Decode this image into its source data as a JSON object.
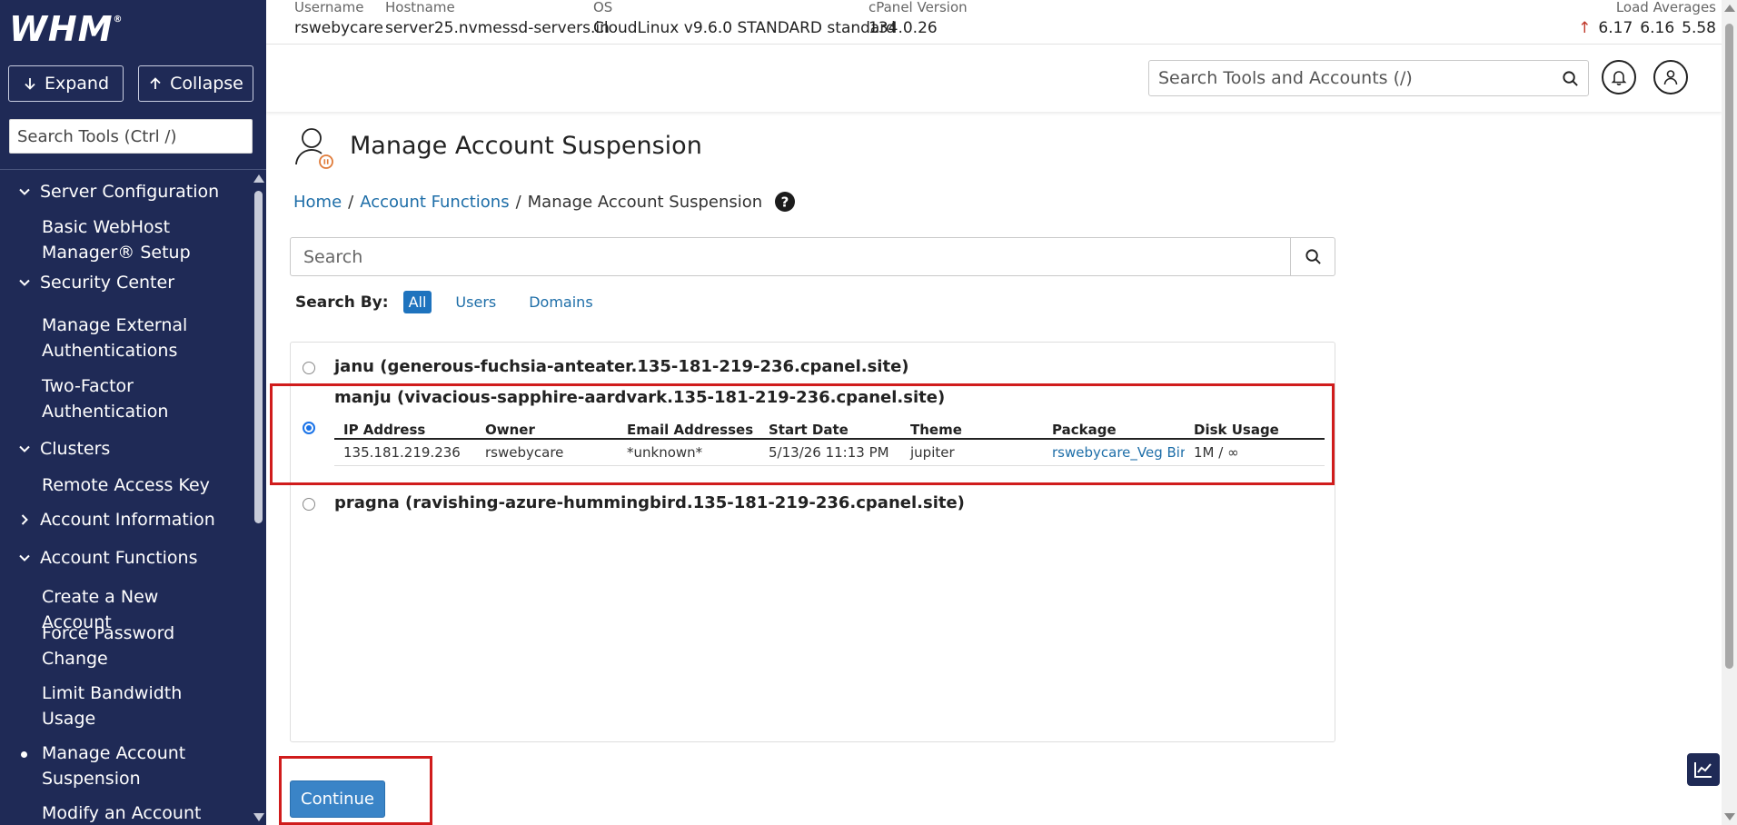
{
  "sidebar": {
    "logo": "WHM",
    "logo_mark": "®",
    "expand_label": "Expand",
    "collapse_label": "Collapse",
    "search_placeholder": "Search Tools (Ctrl /)",
    "sections": [
      {
        "label": "Server Configuration",
        "expanded": true
      },
      {
        "label": "Security Center",
        "expanded": true
      },
      {
        "label": "Clusters",
        "expanded": true
      },
      {
        "label": "Account Information",
        "expanded": false
      },
      {
        "label": "Account Functions",
        "expanded": true
      }
    ],
    "items": [
      {
        "label": "Basic WebHost Manager® Setup"
      },
      {
        "label": "Manage External Authentications"
      },
      {
        "label": "Two-Factor Authentication"
      },
      {
        "label": "Remote Access Key"
      },
      {
        "label": "Create a New Account"
      },
      {
        "label": "Force Password Change"
      },
      {
        "label": "Limit Bandwidth Usage"
      },
      {
        "label": "Manage Account Suspension",
        "active": true
      },
      {
        "label": "Modify an Account"
      }
    ]
  },
  "server_info": {
    "username_label": "Username",
    "username": "rswebycare",
    "hostname_label": "Hostname",
    "hostname": "server25.nvmessd-servers.in",
    "os_label": "OS",
    "os": "CloudLinux v9.6.0 STANDARD standard",
    "version_label": "cPanel Version",
    "version": "134.0.26",
    "load_label": "Load Averages",
    "load": [
      "6.17",
      "6.16",
      "5.58"
    ]
  },
  "header": {
    "search_placeholder": "Search Tools and Accounts (/)"
  },
  "page": {
    "title": "Manage Account Suspension",
    "breadcrumb": [
      "Home",
      "Account Functions",
      "Manage Account Suspension"
    ],
    "search_placeholder": "Search",
    "search_by_label": "Search By:",
    "search_by_options": [
      "All",
      "Users",
      "Domains"
    ],
    "search_by_selected": "All",
    "continue_label": "Continue"
  },
  "accounts": [
    {
      "label": "janu (generous-fuchsia-anteater.135-181-219-236.cpanel.site)",
      "selected": false
    },
    {
      "label": "manju (vivacious-sapphire-aardvark.135-181-219-236.cpanel.site)",
      "selected": true
    },
    {
      "label": "pragna (ravishing-azure-hummingbird.135-181-219-236.cpanel.site)",
      "selected": false
    }
  ],
  "detail_table": {
    "headers": [
      "IP Address",
      "Owner",
      "Email Addresses",
      "Start Date",
      "Theme",
      "Package",
      "Disk Usage"
    ],
    "row": [
      "135.181.219.236",
      "rswebycare",
      "*unknown*",
      "5/13/26 11:13 PM",
      "jupiter",
      "rswebycare_Veg Biryani",
      "1M / ∞"
    ]
  },
  "colors": {
    "sidebar_bg": "#1f2a56",
    "link": "#1e6ea8",
    "primary_button": "#3a84c7",
    "annotation_red": "#d01c1c",
    "load_up_arrow": "#c0392b"
  }
}
